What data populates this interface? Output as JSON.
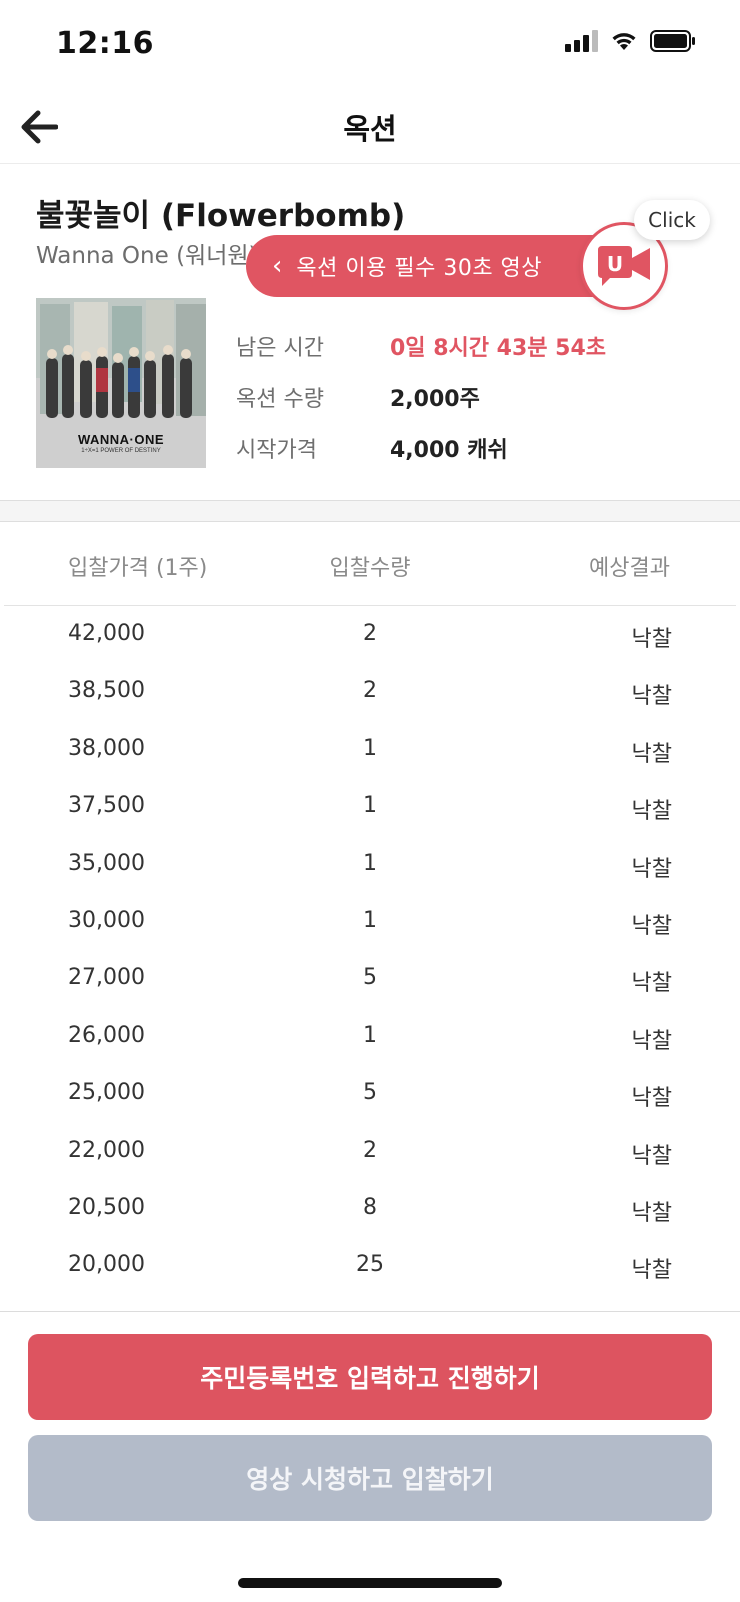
{
  "status_bar": {
    "time": "12:16"
  },
  "nav": {
    "title": "옥션"
  },
  "product": {
    "title": "불꽃놀이 (Flowerbomb)",
    "artist": "Wanna One (워너원)",
    "album_text": "WANNA·ONE",
    "album_subtext": "1÷X=1 POWER OF DESTINY"
  },
  "video_banner": {
    "label": "옥션 이용 필수 30초 영상",
    "tooltip": "Click",
    "icon_letter": "U"
  },
  "info": [
    {
      "label": "남은 시간",
      "value": "0일 8시간 43분 54초"
    },
    {
      "label": "옥션 수량",
      "value": "2,000주"
    },
    {
      "label": "시작가격",
      "value": "4,000 캐쉬"
    }
  ],
  "table": {
    "headers": {
      "price": "입찰가격 (1주)",
      "qty": "입찰수량",
      "result": "예상결과"
    },
    "rows": [
      {
        "price": "42,000",
        "qty": "2",
        "result": "낙찰"
      },
      {
        "price": "38,500",
        "qty": "2",
        "result": "낙찰"
      },
      {
        "price": "38,000",
        "qty": "1",
        "result": "낙찰"
      },
      {
        "price": "37,500",
        "qty": "1",
        "result": "낙찰"
      },
      {
        "price": "35,000",
        "qty": "1",
        "result": "낙찰"
      },
      {
        "price": "30,000",
        "qty": "1",
        "result": "낙찰"
      },
      {
        "price": "27,000",
        "qty": "5",
        "result": "낙찰"
      },
      {
        "price": "26,000",
        "qty": "1",
        "result": "낙찰"
      },
      {
        "price": "25,000",
        "qty": "5",
        "result": "낙찰"
      },
      {
        "price": "22,000",
        "qty": "2",
        "result": "낙찰"
      },
      {
        "price": "20,500",
        "qty": "8",
        "result": "낙찰"
      },
      {
        "price": "20,000",
        "qty": "25",
        "result": "낙찰"
      }
    ]
  },
  "buttons": {
    "primary": "주민등록번호 입력하고 진행하기",
    "secondary": "영상 시청하고 입찰하기"
  },
  "colors": {
    "accent": "#dd5460",
    "disabled": "#b3bbc9"
  }
}
